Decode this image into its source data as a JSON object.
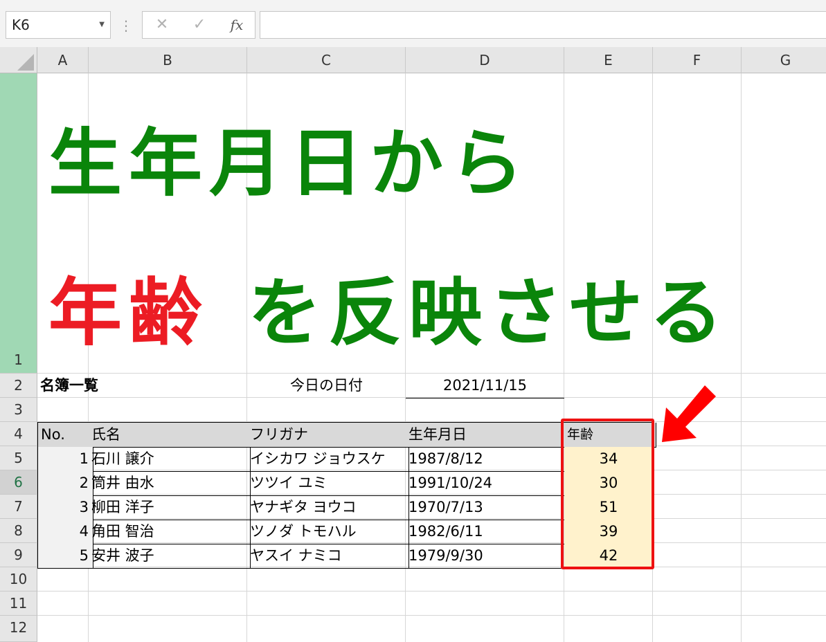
{
  "namebox": {
    "value": "K6"
  },
  "formula_bar": {
    "cancel_icon": "✕",
    "enter_icon": "✓",
    "fx_icon": "fx",
    "content": ""
  },
  "columns": [
    "A",
    "B",
    "C",
    "D",
    "E",
    "F",
    "G"
  ],
  "rows": [
    "1",
    "2",
    "3",
    "4",
    "5",
    "6",
    "7",
    "8",
    "9",
    "10",
    "11",
    "12"
  ],
  "title": {
    "line1": "生年月日から",
    "line2_red": "年齢",
    "line2_green": "を反映させる"
  },
  "sheet": {
    "list_title": "名簿一覧",
    "today_label": "今日の日付",
    "today_value": "2021/11/15",
    "headers": {
      "no": "No.",
      "name": "氏名",
      "kana": "フリガナ",
      "birth": "生年月日",
      "age": "年齢"
    },
    "records": [
      {
        "no": "1",
        "name": "石川 譲介",
        "kana": "イシカワ ジョウスケ",
        "birth": "1987/8/12",
        "age": "34"
      },
      {
        "no": "2",
        "name": "筒井 由水",
        "kana": "ツツイ ユミ",
        "birth": "1991/10/24",
        "age": "30"
      },
      {
        "no": "3",
        "name": "柳田 洋子",
        "kana": "ヤナギタ ヨウコ",
        "birth": "1970/7/13",
        "age": "51"
      },
      {
        "no": "4",
        "name": "角田 智治",
        "kana": "ツノダ トモハル",
        "birth": "1982/6/11",
        "age": "39"
      },
      {
        "no": "5",
        "name": "安井 波子",
        "kana": "ヤスイ ナミコ",
        "birth": "1979/9/30",
        "age": "42"
      }
    ]
  },
  "colors": {
    "green_title": "#0a850a",
    "red_title": "#ec1c24",
    "highlight": "#ee1111",
    "age_fill": "#fff2cc"
  }
}
